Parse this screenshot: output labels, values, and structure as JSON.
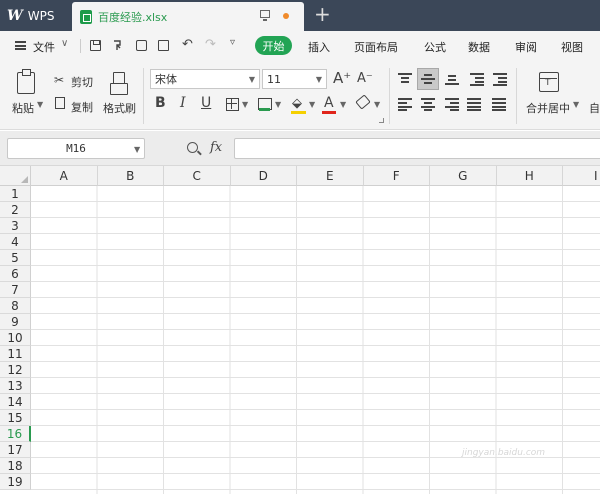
{
  "titlebar": {
    "app_name": "WPS",
    "file_tab": "百度经验.xlsx",
    "new_tab": "+"
  },
  "menubar": {
    "file": "文件",
    "items": [
      "开始",
      "插入",
      "页面布局",
      "公式",
      "数据",
      "审阅",
      "视图"
    ]
  },
  "ribbon": {
    "paste": "粘贴",
    "cut": "剪切",
    "copy": "复制",
    "format_painter": "格式刷",
    "font_name": "宋体",
    "font_size": "11",
    "grow_font": "A⁺",
    "shrink_font": "A⁻",
    "bold": "B",
    "italic": "I",
    "underline": "U",
    "font_color_glyph": "A",
    "merge_center": "合并居中",
    "auto": "自"
  },
  "formulabar": {
    "name_box": "M16",
    "fx": "fx",
    "formula": ""
  },
  "sheet": {
    "columns": [
      "A",
      "B",
      "C",
      "D",
      "E",
      "F",
      "G",
      "H",
      "I"
    ],
    "rows": [
      "1",
      "2",
      "3",
      "4",
      "5",
      "6",
      "7",
      "8",
      "9",
      "10",
      "11",
      "12",
      "13",
      "14",
      "15",
      "16",
      "17",
      "18",
      "19"
    ],
    "active_row": "16"
  },
  "watermark": "jingyan.baidu.com",
  "colors": {
    "titlebar_bg": "#3b4758",
    "accent_green": "#22a454",
    "fill_color": "#f5d000",
    "font_color": "#e0251b"
  }
}
